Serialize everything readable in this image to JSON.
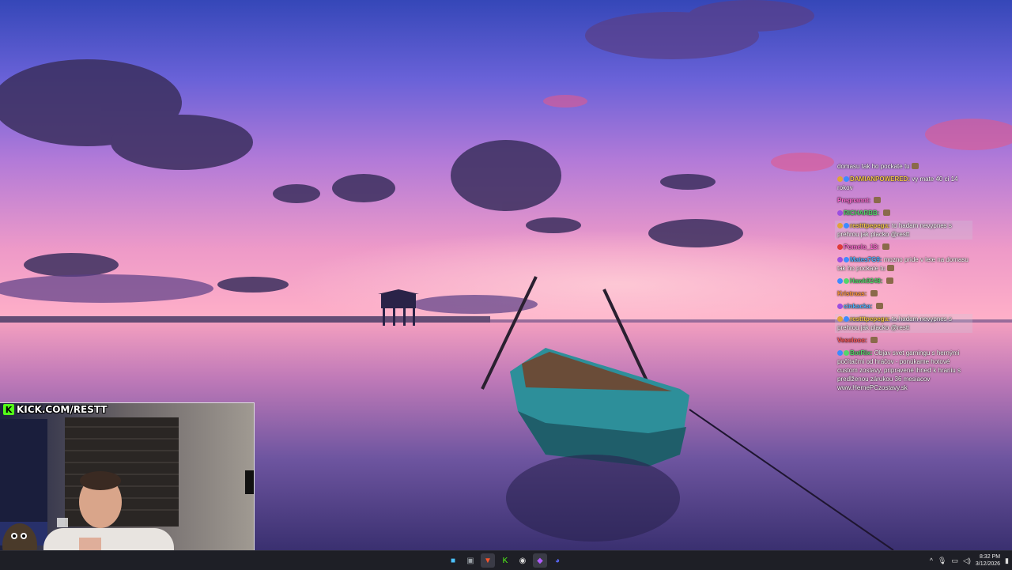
{
  "stream": {
    "banner_text": "KICK.COM/RESTT"
  },
  "chat": {
    "messages": [
      {
        "user": "",
        "user_color": "#ffffff",
        "text": "domasu tak ho pockate tu",
        "badges": [],
        "highlight": false
      },
      {
        "user": "DAMIANPOWERED:",
        "user_color": "#f2c84b",
        "text": "vy mate 40 ci 14 rokov",
        "badges": [
          "orange",
          "sub"
        ],
        "highlight": false
      },
      {
        "user": "Pregnannt:",
        "user_color": "#ff6bd1",
        "text": "",
        "badges": [],
        "highlight": false
      },
      {
        "user": "RICHARBB:",
        "user_color": "#53d66b",
        "text": "",
        "badges": [
          "purple"
        ],
        "highlight": false
      },
      {
        "user": "restttpepega:",
        "user_color": "#f2c84b",
        "text": "to hadam nevypnes s prehrou jak placko @restt",
        "badges": [
          "orange",
          "sub"
        ],
        "highlight": true
      },
      {
        "user": "Pomelo_18:",
        "user_color": "#ff6bd1",
        "text": "",
        "badges": [
          "red"
        ],
        "highlight": false
      },
      {
        "user": "Mates7G9:",
        "user_color": "#4fb3ff",
        "text": "mozno pride v lete na domasu tak ho pockate tu",
        "badges": [
          "purple",
          "sub"
        ],
        "highlight": false
      },
      {
        "user": "Hawk9248:",
        "user_color": "#53d66b",
        "text": "",
        "badges": [
          "sub",
          "mod"
        ],
        "highlight": false
      },
      {
        "user": "Kristraas:",
        "user_color": "#ff9a3d",
        "text": "",
        "badges": [],
        "highlight": false
      },
      {
        "user": "cinkacka:",
        "user_color": "#4fb3ff",
        "text": "",
        "badges": [
          "purple"
        ],
        "highlight": false
      },
      {
        "user": "restttpepega:",
        "user_color": "#f2c84b",
        "text": "to hadam nevypnes s prehrou jak placko @restt",
        "badges": [
          "orange",
          "sub"
        ],
        "highlight": true
      },
      {
        "user": "Veselooo:",
        "user_color": "#ff5a5a",
        "text": "",
        "badges": [],
        "highlight": false
      },
      {
        "user": "BotRix:",
        "user_color": "#53d66b",
        "text": "Objav svet gamingu s hernými počítačmi od hráčov - ponúkame hotové custom zostavy, pripravené ihneď k hraniu s predĺženou zárukou 36 mesiacov www.HernePCzostavy.sk",
        "badges": [
          "sub",
          "mod"
        ],
        "highlight": false
      }
    ]
  },
  "taskbar": {
    "apps": [
      {
        "icon": "windows-start-icon",
        "glyph": "■",
        "color": "#4cc2ff",
        "active": false
      },
      {
        "icon": "widgets-icon",
        "glyph": "▣",
        "color": "#9aa0a6",
        "active": false
      },
      {
        "icon": "brave-browser-icon",
        "glyph": "▼",
        "color": "#fb542b",
        "active": true
      },
      {
        "icon": "kick-app-icon",
        "glyph": "K",
        "color": "#53fc18",
        "active": false
      },
      {
        "icon": "obs-icon",
        "glyph": "◉",
        "color": "#dddddd",
        "active": false
      },
      {
        "icon": "streamlabs-icon",
        "glyph": "◆",
        "color": "#b05cff",
        "active": true
      },
      {
        "icon": "discord-icon",
        "glyph": "◕",
        "color": "#5865f2",
        "active": false
      }
    ],
    "tray": {
      "chevron": "^",
      "time": "8:32 PM",
      "date": "3/12/2026"
    }
  },
  "colors": {
    "sky_top": "#3a4fc0",
    "sky_mid": "#b06ad6",
    "horizon": "#ff8fb8",
    "water": "#7a5aa0",
    "kick_green": "#53fc18"
  }
}
